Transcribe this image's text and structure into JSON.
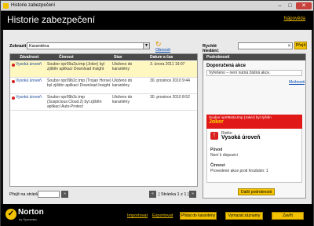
{
  "window": {
    "title": "Historie zabezpečení"
  },
  "header": {
    "title": "Historie zabezpečení",
    "help_link": "Nápověda"
  },
  "filter": {
    "label": "Zobrazit",
    "value": "Karanténa",
    "refresh_link": "Obnovit seznam"
  },
  "quick_search": {
    "label": "Rychlé hledání:",
    "value": "",
    "button": "Přejít"
  },
  "table": {
    "headers": [
      "Závažnost",
      "Činnost",
      "Stav",
      "Datum a čas"
    ],
    "rows": [
      {
        "severity": "Vysoká úroveň",
        "action": "Soubor opr09a2a.tmp (Joker) byl zjištěn aplikací Download Insight",
        "status": "Uloženo do karantény",
        "datetime": "3. února 2011 19:07"
      },
      {
        "severity": "Vysoká úroveň",
        "action": "Soubor opr09b2c.tmp (Trojan Horse) byl zjištěn aplikací Download Insight",
        "status": "Uloženo do karantény",
        "datetime": "30. prosince 2010 9:44"
      },
      {
        "severity": "Vysoká úroveň",
        "action": "Soubor opr09b3c.tmp (Suspicious.Cloud.2) byl zjištěn aplikací Auto-Protect",
        "status": "Uloženo do karantény",
        "datetime": "30. prosince 2010 8:52"
      }
    ]
  },
  "pager": {
    "label": "Přejít na stránku:",
    "input": "",
    "go": "»",
    "prev": "«",
    "info": "[ Stránka 1 z 1 ]",
    "next": "»"
  },
  "details": {
    "header": "Podrobnosti",
    "recommended_title": "Doporučená akce",
    "recommended_value": "Vyřešeno – není nutná žádná akce.",
    "more_options": "Možnosti",
    "red_banner_small": "Soubor opr09a2a.tmp (Joker) byl zjištěn",
    "red_banner_big": "Joker",
    "risk_label": "Riziko",
    "risk_value": "Vysoká úroveň",
    "origin_label": "Původ",
    "origin_value": "Není k dispozici",
    "activity_label": "Činnost",
    "activity_value": "Provedené akce proti hrozbám: 1",
    "more_details_button": "Další podrobnosti"
  },
  "footer": {
    "brand": "Norton",
    "brand_sub": "by Symantec",
    "import_link": "Importovat",
    "export_link": "Exportovat",
    "add_button": "Přidat do karantény",
    "clear_button": "Vymazat záznamy",
    "close_button": "Zavřít"
  },
  "colors": {
    "accent": "#f2c200",
    "danger": "#e01818",
    "link": "#0046b0"
  }
}
